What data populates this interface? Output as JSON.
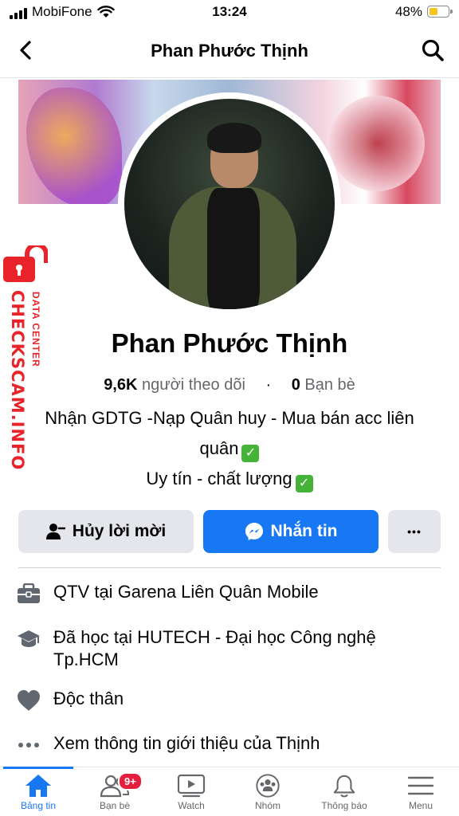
{
  "status_bar": {
    "carrier": "MobiFone",
    "time": "13:24",
    "battery_percent": "48%",
    "battery_level": 0.48
  },
  "header": {
    "title": "Phan Phước Thịnh",
    "back_icon": "chevron-left-icon",
    "search_icon": "search-icon"
  },
  "profile": {
    "name": "Phan Phước Thịnh",
    "followers_count": "9,6K",
    "followers_label": "người theo dõi",
    "separator": "·",
    "friends_count": "0",
    "friends_label": "Bạn bè",
    "bio_line1": "Nhận GDTG -Nạp Quân huy - Mua bán acc liên quân",
    "bio_line2": "Uy tín - chất lượng"
  },
  "watermark": {
    "big": "CHECKSCAM.INFO",
    "small": "DATA CENTER"
  },
  "actions": {
    "cancel_label": "Hủy lời mời",
    "message_label": "Nhắn tin",
    "more_label": "•••"
  },
  "info": {
    "work_prefix": "QTV tại ",
    "work_place": "Garena Liên Quân Mobile",
    "edu_prefix": "Đã học tại ",
    "edu_place": "HUTECH - Đại học Công nghệ Tp.HCM",
    "relationship": "Độc thân",
    "see_about": "Xem thông tin giới thiệu của Thịnh"
  },
  "tabbar": {
    "home": "Bảng tin",
    "friends": "Bạn bè",
    "friends_badge": "9+",
    "watch": "Watch",
    "groups": "Nhóm",
    "notifications": "Thông báo",
    "menu": "Menu"
  },
  "colors": {
    "accent": "#1877f2",
    "badge": "#e41e3f",
    "watermark": "#e8242a"
  }
}
